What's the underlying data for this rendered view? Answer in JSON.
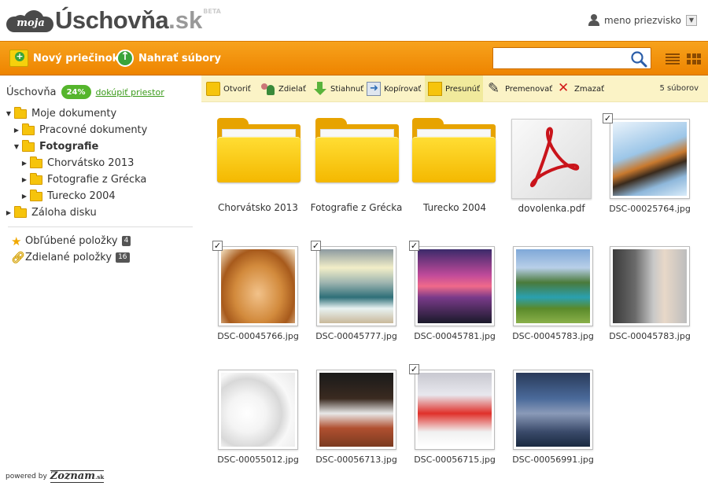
{
  "header": {
    "logo_moja": "moja",
    "logo_main": "Úschovňa",
    "logo_sk": ".sk",
    "logo_beta": "BETA",
    "user_name": "meno priezvisko"
  },
  "toolbar": {
    "new_folder": "Nový priečinok",
    "upload": "Nahrať súbory",
    "search_value": "",
    "search_placeholder": ""
  },
  "sidebar": {
    "storage_label": "Úschovňa",
    "storage_percent": "24%",
    "buy_space": "dokúpiť priestor",
    "tree": [
      {
        "label": "Moje dokumenty"
      },
      {
        "label": "Pracovné dokumenty"
      },
      {
        "label": "Fotografie"
      },
      {
        "label": "Chorvátsko 2013"
      },
      {
        "label": "Fotografie z Grécka"
      },
      {
        "label": "Turecko 2004"
      },
      {
        "label": "Záloha disku"
      }
    ],
    "favorites_label": "Obľúbené položky",
    "favorites_count": "4",
    "shared_label": "Zdielané položky",
    "shared_count": "16",
    "powered_by": "powered by",
    "zoznam": "Zoznam",
    "zoznam_sk": ".sk"
  },
  "actions": {
    "open": "Otvoriť",
    "share": "Zdielať",
    "download": "Stiahnuť",
    "copy": "Kopírovať",
    "move": "Presunúť",
    "rename": "Premenovať",
    "delete": "Zmazať",
    "file_count": "5 súborov"
  },
  "items": [
    {
      "name": "Chorvátsko 2013",
      "type": "folder"
    },
    {
      "name": "Fotografie z Grécka",
      "type": "folder"
    },
    {
      "name": "Turecko 2004",
      "type": "folder"
    },
    {
      "name": "dovolenka.pdf",
      "type": "pdf"
    },
    {
      "name": "DSC-00025764.jpg",
      "type": "image",
      "checked": true
    },
    {
      "name": "DSC-00045766.jpg",
      "type": "image",
      "checked": true
    },
    {
      "name": "DSC-00045777.jpg",
      "type": "image",
      "checked": true
    },
    {
      "name": "DSC-00045781.jpg",
      "type": "image",
      "checked": true
    },
    {
      "name": "DSC-00045783.jpg",
      "type": "image",
      "checked": false
    },
    {
      "name": "DSC-00045783.jpg",
      "type": "image",
      "checked": false
    },
    {
      "name": "DSC-00055012.jpg",
      "type": "image",
      "checked": false
    },
    {
      "name": "DSC-00056713.jpg",
      "type": "image",
      "checked": false
    },
    {
      "name": "DSC-00056715.jpg",
      "type": "image",
      "checked": true
    },
    {
      "name": "DSC-00056991.jpg",
      "type": "image",
      "checked": false
    }
  ],
  "check_mark": "✓",
  "colors": {
    "accent_orange": "#f29100",
    "action_bar": "#fbf3c6",
    "storage_green": "#55b52c"
  }
}
